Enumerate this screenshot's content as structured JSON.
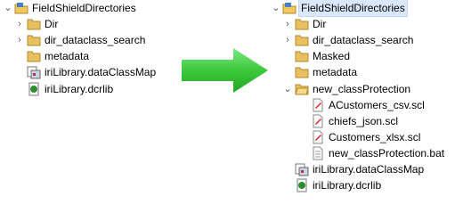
{
  "left_tree": {
    "project": "FieldShieldDirectories",
    "items": [
      "Dir",
      "dir_dataclass_search",
      "metadata",
      "iriLibrary.dataClassMap",
      "iriLibrary.dcrlib"
    ]
  },
  "right_tree": {
    "project": "FieldShieldDirectories",
    "items": [
      "Dir",
      "dir_dataclass_search",
      "Masked",
      "metadata",
      "new_classProtection",
      "iriLibrary.dataClassMap",
      "iriLibrary.dcrlib"
    ],
    "children": [
      "ACustomers_csv.scl",
      "chiefs_json.scl",
      "Customers_xlsx.scl",
      "new_classProtection.bat"
    ]
  },
  "colors": {
    "arrow": "#3cc83c",
    "folder": "#e8c060",
    "selection": "#d9e8fb"
  },
  "icons": [
    "project-icon",
    "folder-icon",
    "datamap-icon",
    "library-icon",
    "scl-file-icon",
    "bat-file-icon",
    "chevron-right-icon",
    "chevron-down-icon"
  ]
}
